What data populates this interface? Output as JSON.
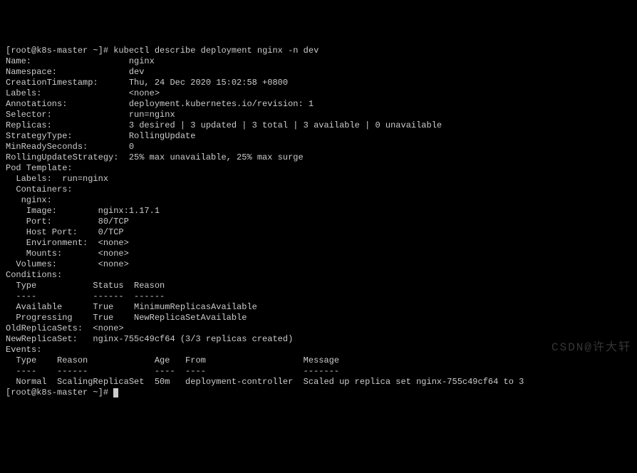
{
  "prompt": "[root@k8s-master ~]# ",
  "command": "kubectl describe deployment nginx -n dev",
  "deployment": {
    "Name": "nginx",
    "Namespace": "dev",
    "CreationTimestamp": "Thu, 24 Dec 2020 15:02:58 +0800",
    "Labels": "<none>",
    "Annotations": "deployment.kubernetes.io/revision: 1",
    "Selector": "run=nginx",
    "Replicas": "3 desired | 3 updated | 3 total | 3 available | 0 unavailable",
    "StrategyType": "RollingUpdate",
    "MinReadySeconds": "0",
    "RollingUpdateStrategy": "25% max unavailable, 25% max surge"
  },
  "podTemplate": {
    "header": "Pod Template:",
    "labelsLine": "  Labels:  run=nginx",
    "containersHeader": "  Containers:",
    "containerName": "   nginx:",
    "container": {
      "Image": "nginx:1.17.1",
      "Port": "80/TCP",
      "HostPort": "0/TCP",
      "Environment": "<none>",
      "Mounts": "<none>"
    },
    "volumes": "  Volumes:        <none>"
  },
  "conditions": {
    "header": "Conditions:",
    "columns": "  Type           Status  Reason",
    "divider": "  ----           ------  ------",
    "rows": [
      "  Available      True    MinimumReplicasAvailable",
      "  Progressing    True    NewReplicaSetAvailable"
    ]
  },
  "replicaSets": {
    "old": "OldReplicaSets:  <none>",
    "new": "NewReplicaSet:   nginx-755c49cf64 (3/3 replicas created)"
  },
  "events": {
    "header": "Events:",
    "columns": "  Type    Reason             Age   From                   Message",
    "divider": "  ----    ------             ----  ----                   -------",
    "rows": [
      "  Normal  ScalingReplicaSet  50m   deployment-controller  Scaled up replica set nginx-755c49cf64 to 3"
    ]
  },
  "prompt2": "[root@k8s-master ~]# ",
  "watermark": "CSDN@许大轩"
}
